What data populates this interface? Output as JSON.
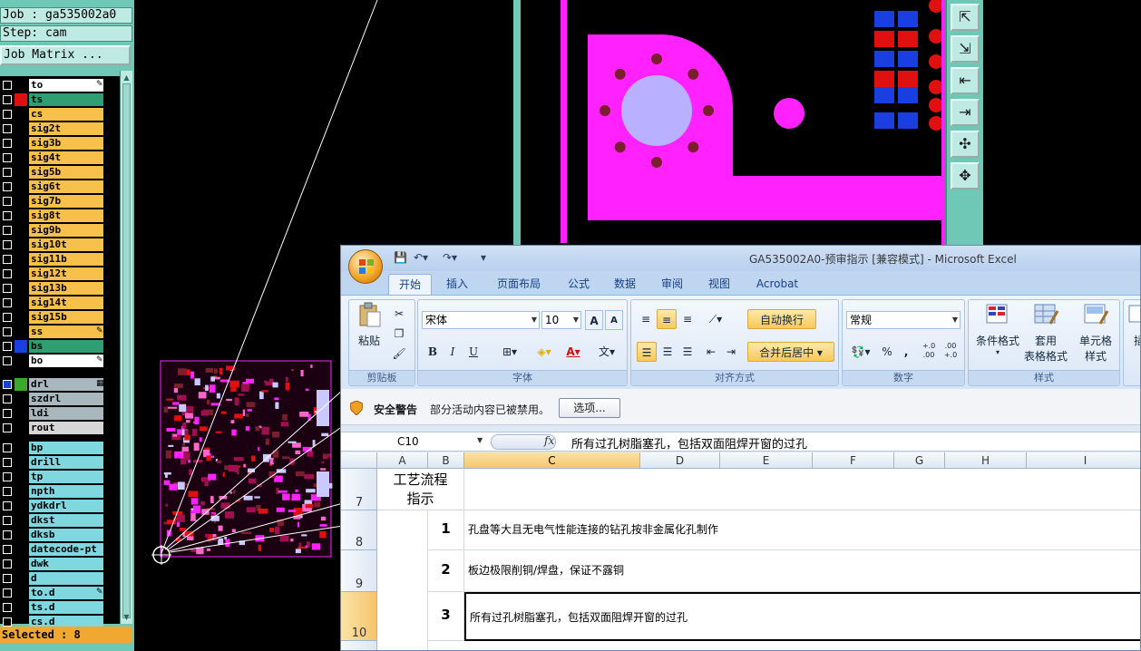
{
  "cam": {
    "job_label": "Job : ga535002a0",
    "step_label": "Step: cam",
    "job_matrix_button": "Job Matrix ...",
    "selected_label": "Selected : 8",
    "colors": {
      "panel": "#6fc8b6",
      "signal": "#f7c04b",
      "board": "#c6c6c6",
      "drill": "#a9b7bf",
      "cyan": "#7fd7e0",
      "active": "#2f8f6f"
    },
    "layers": [
      {
        "name": "to",
        "color": "#ffffff",
        "swatch": "",
        "marker": "pencil"
      },
      {
        "name": "ts",
        "color": "#2f9e73",
        "swatch": "#e01010",
        "marker": ""
      },
      {
        "name": "cs",
        "color": "#f7c04b",
        "swatch": "",
        "marker": ""
      },
      {
        "name": "sig2t",
        "color": "#f7c04b",
        "swatch": "",
        "marker": ""
      },
      {
        "name": "sig3b",
        "color": "#f7c04b",
        "swatch": "",
        "marker": ""
      },
      {
        "name": "sig4t",
        "color": "#f7c04b",
        "swatch": "",
        "marker": ""
      },
      {
        "name": "sig5b",
        "color": "#f7c04b",
        "swatch": "",
        "marker": ""
      },
      {
        "name": "sig6t",
        "color": "#f7c04b",
        "swatch": "",
        "marker": ""
      },
      {
        "name": "sig7b",
        "color": "#f7c04b",
        "swatch": "",
        "marker": ""
      },
      {
        "name": "sig8t",
        "color": "#f7c04b",
        "swatch": "",
        "marker": ""
      },
      {
        "name": "sig9b",
        "color": "#f7c04b",
        "swatch": "",
        "marker": ""
      },
      {
        "name": "sig10t",
        "color": "#f7c04b",
        "swatch": "",
        "marker": ""
      },
      {
        "name": "sig11b",
        "color": "#f7c04b",
        "swatch": "",
        "marker": ""
      },
      {
        "name": "sig12t",
        "color": "#f7c04b",
        "swatch": "",
        "marker": ""
      },
      {
        "name": "sig13b",
        "color": "#f7c04b",
        "swatch": "",
        "marker": ""
      },
      {
        "name": "sig14t",
        "color": "#f7c04b",
        "swatch": "",
        "marker": ""
      },
      {
        "name": "sig15b",
        "color": "#f7c04b",
        "swatch": "",
        "marker": ""
      },
      {
        "name": "ss",
        "color": "#f7c04b",
        "swatch": "",
        "marker": "pencil"
      },
      {
        "name": "bs",
        "color": "#2f9e73",
        "swatch": "#1a3fe0",
        "marker": ""
      },
      {
        "name": "bo",
        "color": "#ffffff",
        "swatch": "",
        "marker": "pencil"
      },
      {
        "name": "drl",
        "color": "#a9b7bf",
        "swatch": "#3aaa2a",
        "marker": "grid",
        "checked_blue": true
      },
      {
        "name": "szdrl",
        "color": "#a9b7bf",
        "swatch": "",
        "marker": ""
      },
      {
        "name": "ldi",
        "color": "#a9b7bf",
        "swatch": "",
        "marker": ""
      },
      {
        "name": "rout",
        "color": "#d6d6d6",
        "swatch": "",
        "marker": ""
      },
      {
        "name": "bp",
        "color": "#7fd7e0",
        "swatch": "",
        "marker": ""
      },
      {
        "name": "drill",
        "color": "#7fd7e0",
        "swatch": "",
        "marker": ""
      },
      {
        "name": "tp",
        "color": "#7fd7e0",
        "swatch": "",
        "marker": ""
      },
      {
        "name": "npth",
        "color": "#7fd7e0",
        "swatch": "",
        "marker": ""
      },
      {
        "name": "ydkdrl",
        "color": "#7fd7e0",
        "swatch": "",
        "marker": ""
      },
      {
        "name": "dkst",
        "color": "#7fd7e0",
        "swatch": "",
        "marker": ""
      },
      {
        "name": "dksb",
        "color": "#7fd7e0",
        "swatch": "",
        "marker": ""
      },
      {
        "name": "datecode-pt",
        "color": "#7fd7e0",
        "swatch": "",
        "marker": ""
      },
      {
        "name": "dwk",
        "color": "#7fd7e0",
        "swatch": "",
        "marker": ""
      },
      {
        "name": "d",
        "color": "#7fd7e0",
        "swatch": "",
        "marker": ""
      },
      {
        "name": "to.d",
        "color": "#7fd7e0",
        "swatch": "",
        "marker": "pencil"
      },
      {
        "name": "ts.d",
        "color": "#7fd7e0",
        "swatch": "",
        "marker": ""
      },
      {
        "name": "cs.d",
        "color": "#7fd7e0",
        "swatch": "",
        "marker": ""
      }
    ],
    "toolbar_icons": [
      "zoom-home-icon",
      "zoom-back-icon",
      "pan-left-icon",
      "pan-right-icon",
      "zoom-fit-icon",
      "zoom-center-icon"
    ]
  },
  "excel": {
    "title": "GA535002A0-预审指示  [兼容模式] - Microsoft Excel",
    "tabs": [
      "开始",
      "插入",
      "页面布局",
      "公式",
      "数据",
      "审阅",
      "视图",
      "Acrobat"
    ],
    "active_tab": 0,
    "ribbon": {
      "clipboard": {
        "paste": "粘贴",
        "group": "剪贴板"
      },
      "font": {
        "name": "宋体",
        "size": "10",
        "bold": "B",
        "italic": "I",
        "underline": "U",
        "font_color_letter": "A",
        "phonetic": "文",
        "group": "字体"
      },
      "alignment": {
        "wrap": "自动换行",
        "merge": "合并后居中",
        "group": "对齐方式"
      },
      "number": {
        "format": "常规",
        "percent": "%",
        "comma": ",",
        "inc": "+.0 .00",
        "dec": ".00 +.0",
        "group": "数字"
      },
      "styles": {
        "cond": "条件格式",
        "table1": "套用",
        "table2": "表格格式",
        "cell1": "单元格",
        "cell2": "样式",
        "group": "样式"
      },
      "insert_partial": "插"
    },
    "security": {
      "title": "安全警告",
      "message": "部分活动内容已被禁用。",
      "options": "选项..."
    },
    "formula_bar": {
      "cell_ref": "C10",
      "fx": "fx",
      "content": "所有过孔树脂塞孔，包括双面阻焊开窗的过孔"
    },
    "columns": [
      "A",
      "B",
      "C",
      "D",
      "E",
      "F",
      "G",
      "H",
      "I"
    ],
    "selected_column": "C",
    "rows": [
      {
        "num": "7",
        "a": "工艺流程指示",
        "b": "",
        "c": ""
      },
      {
        "num": "8",
        "a": "",
        "b": "1",
        "c": "孔盘等大且无电气性能连接的钻孔按非金属化孔制作"
      },
      {
        "num": "9",
        "a": "",
        "b": "2",
        "c": "板边极限削铜/焊盘，保证不露铜"
      },
      {
        "num": "10",
        "a": "",
        "b": "3",
        "c": "所有过孔树脂塞孔，包括双面阻焊开窗的过孔"
      }
    ],
    "a7_line1": "工艺流程",
    "a7_line2": "指示",
    "selected_row": "10"
  },
  "colors": {
    "pcb_pad": "#ff22ff",
    "pcb_hole": "#b9b1ff",
    "pcb_via": "#7a1f2e",
    "pcb_blue": "#1a3fe0",
    "pcb_red": "#e01010"
  }
}
